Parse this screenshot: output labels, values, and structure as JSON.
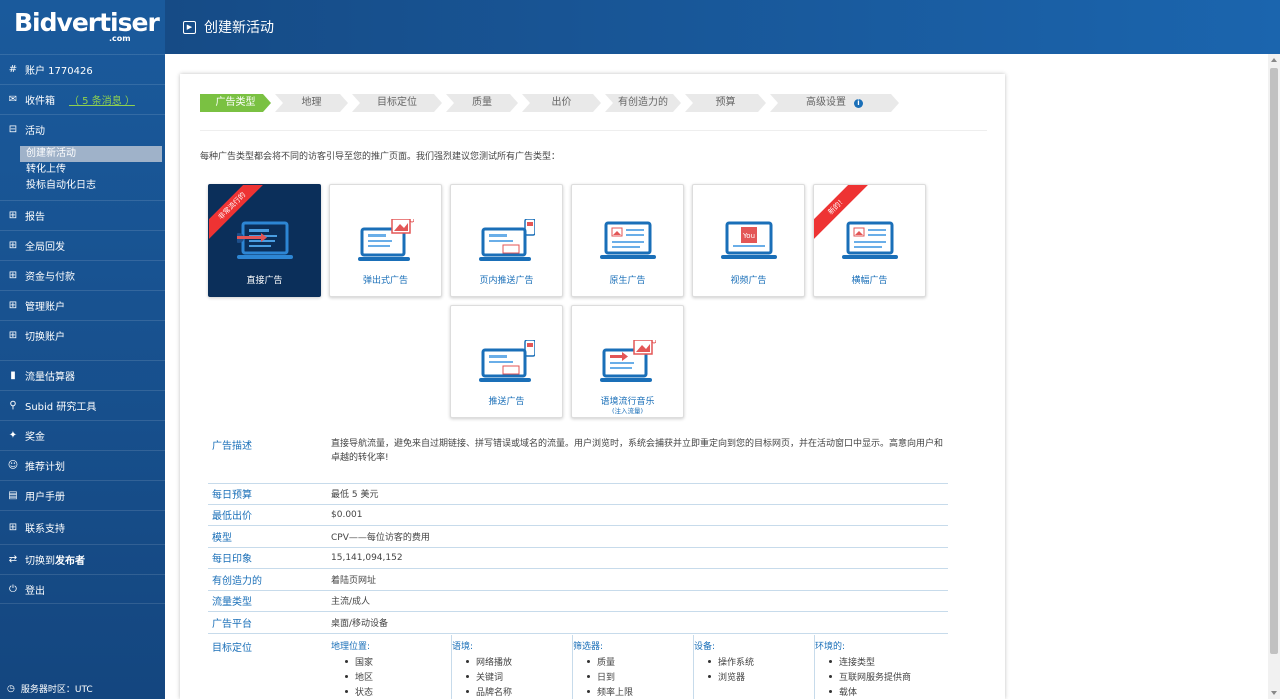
{
  "sidebar": {
    "brand": "Bidvertiser",
    "brand_suffix": ".com",
    "account": "账户 1770426",
    "inbox": "收件箱",
    "inbox_count": "（ 5 条消息 ）",
    "campaigns": "活动",
    "campaigns_sub": [
      "创建新活动",
      "转化上传",
      "投标自动化日志"
    ],
    "reports": "报告",
    "global_postback": "全局回发",
    "funds": "资金与付款",
    "manage_account": "管理账户",
    "switch_account": "切换账户",
    "traffic_estimator": "流量估算器",
    "subid_tool": "Subid 研究工具",
    "awards": "奖金",
    "referral": "推荐计划",
    "manual": "用户手册",
    "support": "联系支持",
    "switch_publisher_prefix": "切换到",
    "switch_publisher_bold": "发布者",
    "logout": "登出",
    "timezone": "服务器时区：UTC"
  },
  "header": {
    "title": "创建新活动"
  },
  "steps": [
    "广告类型",
    "地理",
    "目标定位",
    "质量",
    "出价",
    "有创造力的",
    "预算",
    "高级设置"
  ],
  "intro": "每种广告类型都会将不同的访客引导至您的推广页面。我们强烈建议您测试所有广告类型：",
  "tiles": [
    {
      "label": "直接广告",
      "ribbon": "非常流行的",
      "selected": true
    },
    {
      "label": "弹出式广告"
    },
    {
      "label": "页内推送广告"
    },
    {
      "label": "原生广告"
    },
    {
      "label": "视频广告"
    },
    {
      "label": "横幅广告",
      "ribbon": "新的！"
    },
    {
      "label": "推送广告"
    },
    {
      "label": "语境流行音乐",
      "sub": "(注入流量)"
    }
  ],
  "description": {
    "label": "广告描述",
    "text": "直接导航流量，避免来自过期链接、拼写错误或域名的流量。用户浏览时，系统会捕获并立即重定向到您的目标网页，并在活动窗口中显示。高意向用户和卓越的转化率!"
  },
  "params": [
    {
      "k": "每日预算",
      "v": "最低 5 美元"
    },
    {
      "k": "最低出价",
      "v": "$0.001"
    },
    {
      "k": "模型",
      "v": "CPV——每位访客的费用"
    },
    {
      "k": "每日印象",
      "v": "15,141,094,152"
    },
    {
      "k": "有创造力的",
      "v": "着陆页网址"
    },
    {
      "k": "流量类型",
      "v": "主流/成人"
    },
    {
      "k": "广告平台",
      "v": "桌面/移动设备"
    }
  ],
  "targeting": {
    "label": "目标定位",
    "cols": [
      {
        "h": "地理位置:",
        "items": [
          "国家",
          "地区",
          "状态"
        ]
      },
      {
        "h": "语境:",
        "items": [
          "网络播放",
          "关键词",
          "品牌名称"
        ]
      },
      {
        "h": "筛选器:",
        "items": [
          "质量",
          "日到",
          "频率上限"
        ]
      },
      {
        "h": "设备:",
        "items": [
          "操作系统",
          "浏览器"
        ]
      },
      {
        "h": "环境的:",
        "items": [
          "连接类型",
          "互联网服务提供商",
          "载体"
        ]
      }
    ]
  },
  "colors": {
    "accent": "#1a6fb8",
    "step_active": "#7ac142",
    "sidebar": "#174f8c",
    "selected_tile": "#0b2f5a",
    "ribbon": "#e33333"
  }
}
